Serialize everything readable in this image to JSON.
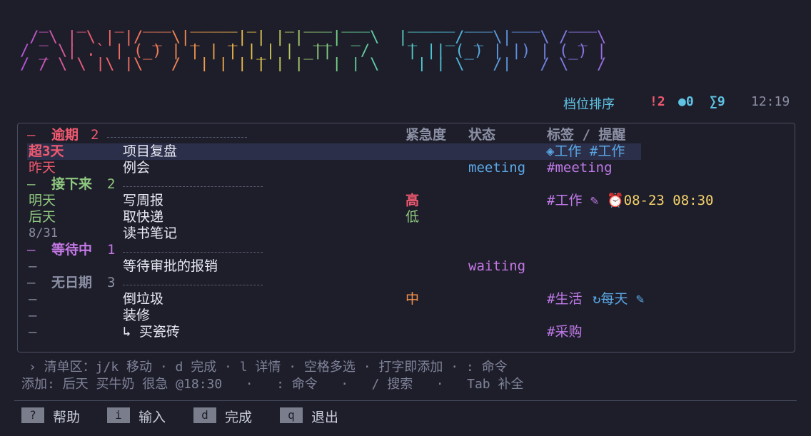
{
  "banner": {
    "text": "  _   _   _  ___  _____ _   _ ___ ___    _____ ___  ___   ___\n /_\\ | \\ | |/ _ \\|_   _| | | | __| _ \\  |_   _/ _ \\|   \\ / _ \\\n/ _ \\| .` | (_) | | | | |_| | _||   /    | || (_) | |) | (_) |\n/_/ \\_\\_|\\_|\\___/  |_| |_| |_|___|_|_\\    |_| \\___/|___/ \\___/"
  },
  "status": {
    "sort": "档位排序",
    "urgent": "!2",
    "dot": "●0",
    "sigma": "∑9",
    "time": "12:19"
  },
  "columns": {
    "urgency": "紧急度",
    "state": "状态",
    "tags": "标签 / 提醒"
  },
  "sections": [
    {
      "prefix": "—",
      "title": "逾期",
      "count": "2"
    },
    {
      "prefix": "—",
      "title": "接下来",
      "count": "2"
    },
    {
      "prefix": "—",
      "title": "等待中",
      "count": "1"
    },
    {
      "prefix": "—",
      "title": "无日期",
      "count": "3"
    }
  ],
  "rows": [
    {
      "date": "超3天",
      "title": "项目复盘",
      "urgency": "",
      "state": "",
      "tags": "◈工作 #工作"
    },
    {
      "date": "昨天",
      "title": "例会",
      "urgency": "",
      "state": "meeting",
      "tags": "#meeting"
    },
    {
      "date": "明天",
      "title": "写周报",
      "urgency": "高",
      "state": "",
      "tags": "#工作 ✎",
      "reminder": "⏰08-23 08:30"
    },
    {
      "date": "后天",
      "title": "取快递",
      "urgency": "低",
      "state": "",
      "tags": ""
    },
    {
      "date": "8/31",
      "title": "读书笔记",
      "urgency": "",
      "state": "",
      "tags": ""
    },
    {
      "date": "—",
      "title": "等待审批的报销",
      "urgency": "",
      "state": "waiting",
      "tags": ""
    },
    {
      "date": "—",
      "title": "倒垃圾",
      "urgency": "中",
      "state": "",
      "tags": "#生活",
      "repeat": "↻每天 ✎"
    },
    {
      "date": "—",
      "title": "装修",
      "urgency": "",
      "state": "",
      "tags": ""
    },
    {
      "date": "—",
      "title": "↳ 买瓷砖",
      "urgency": "",
      "state": "",
      "tags": "#采购"
    }
  ],
  "hint": {
    "line1": "› 清单区：j/k 移动 · d 完成 · l 详情 · 空格多选 · 打字即添加 · : 命令",
    "line2": "添加: 后天 买牛奶 很急 @18:30   ·   : 命令   ·   / 搜索   ·   Tab 补全"
  },
  "footer": [
    {
      "key": "?",
      "label": "帮助"
    },
    {
      "key": "i",
      "label": "输入"
    },
    {
      "key": "d",
      "label": "完成"
    },
    {
      "key": "q",
      "label": "退出"
    }
  ]
}
